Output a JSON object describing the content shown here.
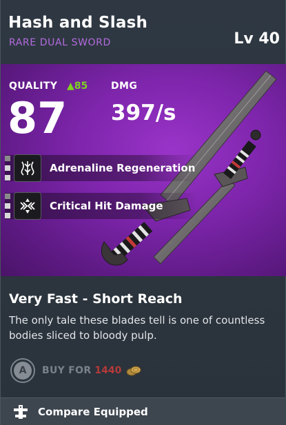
{
  "item": {
    "name": "Hash and Slash",
    "type": "RARE DUAL SWORD",
    "level": "Lv 40",
    "rarity_color": "#b46be0"
  },
  "stats": {
    "quality_label": "QUALITY",
    "quality_delta": "▲85",
    "quality_value": "87",
    "dmg_label": "DMG",
    "dmg_value": "397/s"
  },
  "perks": [
    {
      "label": "Adrenaline Regeneration",
      "icon": "adrenaline-icon"
    },
    {
      "label": "Critical Hit Damage",
      "icon": "critical-hit-icon"
    }
  ],
  "details": {
    "reach": "Very Fast - Short Reach",
    "description": "The only tale these blades tell is one of countless bodies sliced to bloody pulp."
  },
  "buy": {
    "button": "A",
    "label": "BUY FOR",
    "price": "1440",
    "currency_icon": "drachmae-coins-icon"
  },
  "footer": {
    "compare_label": "Compare Equipped",
    "compare_icon": "compare-icon"
  },
  "colors": {
    "hero_purple": "#8a2dbb",
    "quality_green": "#7ed321",
    "price_red": "#b53a3a"
  }
}
